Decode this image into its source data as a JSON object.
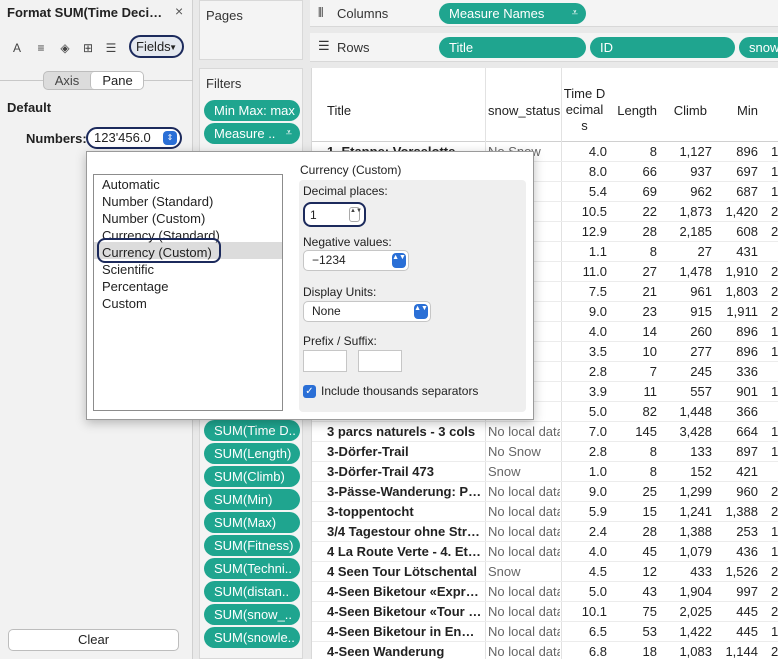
{
  "format_pane": {
    "title": "Format SUM(Time Decimal...",
    "close": "×",
    "toolbar": {
      "font_icon": "A",
      "align_icon": "≡",
      "fill_icon": "◈",
      "borders_icon": "⊞",
      "lines_icon": "☰",
      "fields_label": "Fields",
      "fields_caret": "▼"
    },
    "tabs": {
      "axis": "Axis",
      "pane": "Pane"
    },
    "section": "Default",
    "numbers_label": "Numbers:",
    "numbers_value": "123'456.0",
    "stepper": "⇕",
    "clear": "Clear"
  },
  "shelves": {
    "pages": "Pages",
    "filters": "Filters",
    "columns_icon": "⫴",
    "columns": "Columns",
    "rows_icon": "☰",
    "rows": "Rows",
    "sort_icon": "⩡"
  },
  "column_pills": [
    "Measure Names"
  ],
  "row_pills": [
    "Title",
    "ID",
    "snow"
  ],
  "filter_pills": [
    "Min Max: max",
    "Measure .."
  ],
  "measure_pills": [
    "SUM(Time D..",
    "SUM(Length)",
    "SUM(Climb)",
    "SUM(Min)",
    "SUM(Max)",
    "SUM(Fitness)",
    "SUM(Techni..",
    "SUM(distan..",
    "SUM(snow_..",
    "SUM(snowle.."
  ],
  "table": {
    "headers": {
      "title": "Title",
      "snow_status": "snow_status",
      "time_line1": "Time D",
      "time_line2": "ecimal",
      "time_line3": "s",
      "length": "Length",
      "climb": "Climb",
      "min": "Min"
    },
    "rows": [
      {
        "title": "1. Etappe: Vorselotte - Co...",
        "snow": "No Snow",
        "time": "4.0",
        "length": "8",
        "climb": "1,127",
        "min": "896",
        "more": "1"
      },
      {
        "title": "",
        "snow": "p",
        "time": "8.0",
        "length": "66",
        "climb": "937",
        "min": "697",
        "more": "1"
      },
      {
        "title": "",
        "snow": "p",
        "time": "5.4",
        "length": "69",
        "climb": "962",
        "min": "687",
        "more": "1"
      },
      {
        "title": "",
        "snow": "data",
        "time": "10.5",
        "length": "22",
        "climb": "1,873",
        "min": "1,420",
        "more": "2"
      },
      {
        "title": "",
        "snow": "data",
        "time": "12.9",
        "length": "28",
        "climb": "2,185",
        "min": "608",
        "more": "2"
      },
      {
        "title": "",
        "snow": "p",
        "time": "1.1",
        "length": "8",
        "climb": "27",
        "min": "431",
        "more": ""
      },
      {
        "title": "",
        "snow": "data",
        "time": "11.0",
        "length": "27",
        "climb": "1,478",
        "min": "1,910",
        "more": "2"
      },
      {
        "title": "",
        "snow": "p",
        "time": "7.5",
        "length": "21",
        "climb": "961",
        "min": "1,803",
        "more": "2"
      },
      {
        "title": "",
        "snow": "p",
        "time": "9.0",
        "length": "23",
        "climb": "915",
        "min": "1,911",
        "more": "2"
      },
      {
        "title": "",
        "snow": "p",
        "time": "4.0",
        "length": "14",
        "climb": "260",
        "min": "896",
        "more": "1"
      },
      {
        "title": "",
        "snow": "p",
        "time": "3.5",
        "length": "10",
        "climb": "277",
        "min": "896",
        "more": "1"
      },
      {
        "title": "",
        "snow": "p",
        "time": "2.8",
        "length": "7",
        "climb": "245",
        "min": "336",
        "more": ""
      },
      {
        "title": "",
        "snow": "p",
        "time": "3.9",
        "length": "11",
        "climb": "557",
        "min": "901",
        "more": "1"
      },
      {
        "title": "",
        "snow": "p",
        "time": "5.0",
        "length": "82",
        "climb": "1,448",
        "min": "366",
        "more": ""
      },
      {
        "title": "3 parcs naturels - 3 cols",
        "snow": "No local data",
        "time": "7.0",
        "length": "145",
        "climb": "3,428",
        "min": "664",
        "more": "1"
      },
      {
        "title": "3-Dörfer-Trail",
        "snow": "No Snow",
        "time": "2.8",
        "length": "8",
        "climb": "133",
        "min": "897",
        "more": "1"
      },
      {
        "title": "3-Dörfer-Trail 473",
        "snow": "Snow",
        "time": "1.0",
        "length": "8",
        "climb": "152",
        "min": "421",
        "more": ""
      },
      {
        "title": "3-Pässe-Wanderung: Pani..",
        "snow": "No local data",
        "time": "9.0",
        "length": "25",
        "climb": "1,299",
        "min": "960",
        "more": "2"
      },
      {
        "title": "3-toppentocht",
        "snow": "No local data",
        "time": "5.9",
        "length": "15",
        "climb": "1,241",
        "min": "1,388",
        "more": "2"
      },
      {
        "title": "3/4 Tagestour ohne Stress",
        "snow": "No local data",
        "time": "2.4",
        "length": "28",
        "climb": "1,388",
        "min": "253",
        "more": "1"
      },
      {
        "title": "4 La Route Verte - 4. Etap..",
        "snow": "No local data",
        "time": "4.0",
        "length": "45",
        "climb": "1,079",
        "min": "436",
        "more": "1"
      },
      {
        "title": "4 Seen Tour Lötschental",
        "snow": "Snow",
        "time": "4.5",
        "length": "12",
        "climb": "433",
        "min": "1,526",
        "more": "2"
      },
      {
        "title": "4-Seen Biketour «Express»",
        "snow": "No local data",
        "time": "5.0",
        "length": "43",
        "climb": "1,904",
        "min": "997",
        "more": "2"
      },
      {
        "title": "4-Seen Biketour «Tour +» ..",
        "snow": "No local data",
        "time": "10.1",
        "length": "75",
        "climb": "2,025",
        "min": "445",
        "more": "2"
      },
      {
        "title": "4-Seen Biketour in Engelb..",
        "snow": "No local data",
        "time": "6.5",
        "length": "53",
        "climb": "1,422",
        "min": "445",
        "more": "1"
      },
      {
        "title": "4-Seen Wanderung",
        "snow": "No local data",
        "time": "6.8",
        "length": "18",
        "climb": "1,083",
        "min": "1,144",
        "more": "2"
      }
    ]
  },
  "dialog": {
    "formats": [
      "Automatic",
      "Number (Standard)",
      "Number (Custom)",
      "Currency (Standard)",
      "Currency (Custom)",
      "Scientific",
      "Percentage",
      "Custom"
    ],
    "selected_format": "Currency (Custom)",
    "title": "Currency (Custom)",
    "decimal_label": "Decimal places:",
    "decimal_value": "1",
    "negative_label": "Negative values:",
    "negative_value": "−1234",
    "units_label": "Display Units:",
    "units_value": "None",
    "prefix_label": "Prefix / Suffix:",
    "prefix_value": "",
    "suffix_value": "",
    "thousands_label": "Include thousands separators",
    "thousands_checked": "✓",
    "spin_glyph": "▲▼",
    "dd_glyph": "▲▼"
  }
}
